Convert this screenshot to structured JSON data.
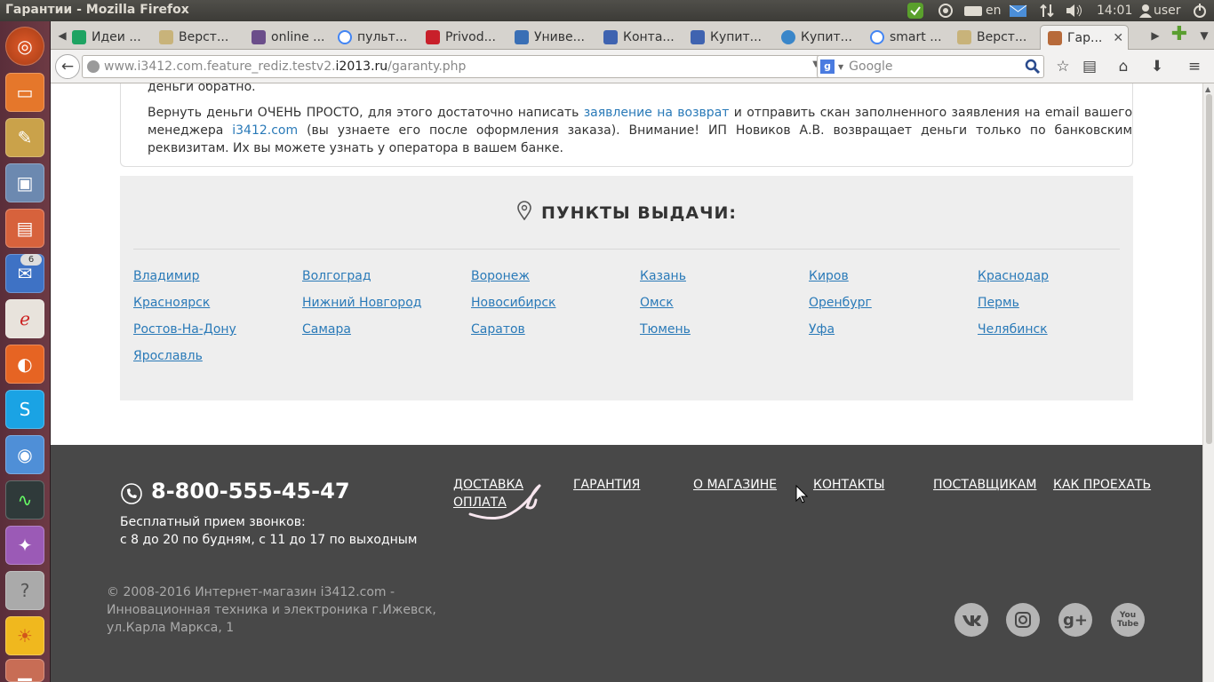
{
  "window": {
    "title": "Гарантии - Mozilla Firefox"
  },
  "indicators": {
    "lang": "en",
    "clock": "14:01",
    "user": "user"
  },
  "launcher": {
    "badge": "6"
  },
  "tabs": [
    {
      "label": "Идеи ..."
    },
    {
      "label": "Верст..."
    },
    {
      "label": "online ..."
    },
    {
      "label": "пульт..."
    },
    {
      "label": "Privod..."
    },
    {
      "label": "Униве..."
    },
    {
      "label": "Конта..."
    },
    {
      "label": "Купит..."
    },
    {
      "label": "Купит..."
    },
    {
      "label": "smart ..."
    },
    {
      "label": "Верст..."
    },
    {
      "label": "Гар..."
    }
  ],
  "nav": {
    "url_prefix": "www.i3412.com.feature_rediz.testv2.",
    "url_domain": "i2013.ru",
    "url_path": "/garanty.php",
    "search_placeholder": "Google"
  },
  "page": {
    "top_line": "деньги обратно.",
    "return_text_1": "Вернуть деньги ОЧЕНЬ ПРОСТО, для этого достаточно написать",
    "return_link": "заявление на возврат",
    "return_text_2": "и отправить скан заполненного заявления на email вашего менеджера",
    "site_link": "i3412.com",
    "return_text_3": "(вы узнаете его после оформления заказа). Внимание! ИП Новиков А.В. возвращает деньги только по банковским реквизитам. Их вы можете узнать у оператора в вашем банке.",
    "pickup_title": "ПУНКТЫ ВЫДАЧИ:",
    "cities": [
      "Владимир",
      "Волгоград",
      "Воронеж",
      "Казань",
      "Киров",
      "Краснодар",
      "Красноярск",
      "Нижний Новгород",
      "Новосибирск",
      "Омск",
      "Оренбург",
      "Пермь",
      "Ростов-На-Дону",
      "Самара",
      "Саратов",
      "Тюмень",
      "Уфа",
      "Челябинск",
      "Ярославль"
    ]
  },
  "footer": {
    "phone": "8-800-555-45-47",
    "note1": "Бесплатный прием звонков:",
    "note2": "с 8 до 20 по будням, с 11 до 17 по выходным",
    "links": [
      "ДОСТАВКА",
      "ОПЛАТА",
      "ГАРАНТИЯ",
      "О МАГАЗИНЕ",
      "КОНТАКТЫ",
      "ПОСТАВЩИКАМ",
      "КАК ПРОЕХАТЬ"
    ],
    "copy1": "© 2008-2016 Интернет-магазин i3412.com -",
    "copy2": "Инновационная техника и электроника г.Ижевск,",
    "copy3": "ул.Карла Маркса, 1",
    "social": [
      {
        "icon": "vk-icon"
      },
      {
        "icon": "instagram-icon"
      },
      {
        "label": "g+",
        "icon": "google-plus-icon"
      },
      {
        "label": "You Tube",
        "icon": "youtube-icon"
      }
    ]
  }
}
